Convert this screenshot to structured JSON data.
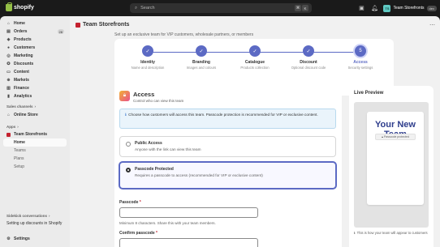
{
  "topbar": {
    "brand": "shopify",
    "search_placeholder": "Search",
    "search_kbd": [
      "⌘",
      "K"
    ],
    "store_name": "Team Storefronts",
    "store_initials": "TS",
    "env_badge": "dev"
  },
  "sidebar": {
    "items": [
      {
        "label": "Home"
      },
      {
        "label": "Orders",
        "badge": "28"
      },
      {
        "label": "Products"
      },
      {
        "label": "Customers"
      },
      {
        "label": "Marketing"
      },
      {
        "label": "Discounts"
      },
      {
        "label": "Content"
      },
      {
        "label": "Markets"
      },
      {
        "label": "Finance"
      },
      {
        "label": "Analytics"
      }
    ],
    "sales_channels_heading": "Sales channels",
    "online_store": "Online Store",
    "apps_heading": "Apps",
    "app_name": "Team Storefronts",
    "app_subitems": [
      "Home",
      "Teams",
      "Plans",
      "Setup"
    ],
    "sidekick": "Sidekick conversations",
    "sidekick_item": "Setting up discounts in Shopify",
    "settings": "Settings"
  },
  "main": {
    "page_title": "Team Storefronts",
    "subtitle": "Set up an exclusive team for VIP customers, wholesale partners, or members",
    "steps": [
      {
        "num": "✓",
        "title": "Identity",
        "desc": "Name and description"
      },
      {
        "num": "✓",
        "title": "Branding",
        "desc": "Images and colours"
      },
      {
        "num": "✓",
        "title": "Catalogue",
        "desc": "Products collection"
      },
      {
        "num": "✓",
        "title": "Discount",
        "desc": "Optional discount code"
      },
      {
        "num": "5",
        "title": "Access",
        "desc": "Security settings"
      }
    ],
    "access": {
      "title": "Access",
      "subtitle": "Control who can view this team",
      "info": "Choose how customers will access this team. Passcode protection is recommended for VIP or exclusive content.",
      "options": [
        {
          "title": "Public Access",
          "desc": "Anyone with the link can view this team"
        },
        {
          "title": "Passcode Protected",
          "desc": "Requires a passcode to access (recommended for VIP or exclusive content)"
        }
      ],
      "passcode_label": "Passcode",
      "passcode_help": "Minimum 8 characters. Share this with your team members.",
      "confirm_label": "Confirm passcode",
      "required_mark": "*"
    },
    "preview": {
      "title": "Live Preview",
      "heading": "Your New Team",
      "pill": "Passcode protected",
      "note": "This is how your team will appear to customers"
    }
  },
  "colors": {
    "accent": "#5c6ac4",
    "preview_heading": "#2e3d8c",
    "brand_green": "#95bf47"
  }
}
